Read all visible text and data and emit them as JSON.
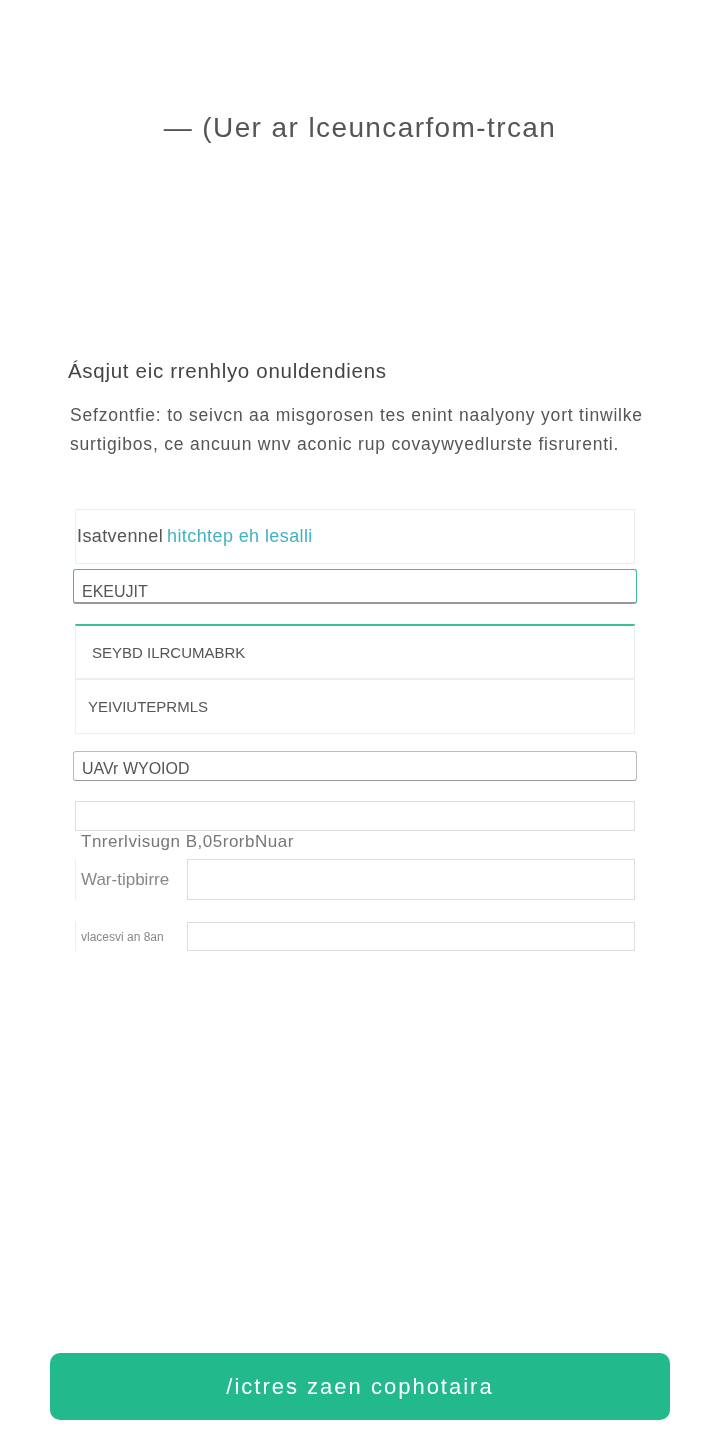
{
  "header": {
    "title": "— (Uer ar lceuncarfom-trcan"
  },
  "intro": {
    "heading": "Ásqjut eic rrenhlyo onuldendiens",
    "text": "Sefzontfie: to seivcn aa misgorosen tes enint naalyony yort tinwilke surtigibos, ce ancuun wnv aconic rup covaywyedlurste fisrurenti."
  },
  "form": {
    "fields": [
      {
        "kind": "link_row",
        "label": "Isatvennel",
        "link": "hitchtep eh lesalli"
      },
      {
        "kind": "input",
        "value": "EKEUJIT",
        "focused": true
      },
      {
        "kind": "option",
        "label": "SEYBD ILRCUMABRK",
        "selected": true
      },
      {
        "kind": "option",
        "label": "YEIVIUTEPRMLS",
        "selected": false
      },
      {
        "kind": "input",
        "value": "UAVr WYOIOD",
        "focused": false
      },
      {
        "kind": "field_below",
        "label": "Tnrerlvisugn B,05rorbNuar"
      },
      {
        "kind": "inline",
        "label": "War-tipbirre"
      },
      {
        "kind": "inline",
        "label": "vlacesvi an 8an"
      }
    ]
  },
  "button": {
    "label": "/ictres zaen cophotaira"
  }
}
